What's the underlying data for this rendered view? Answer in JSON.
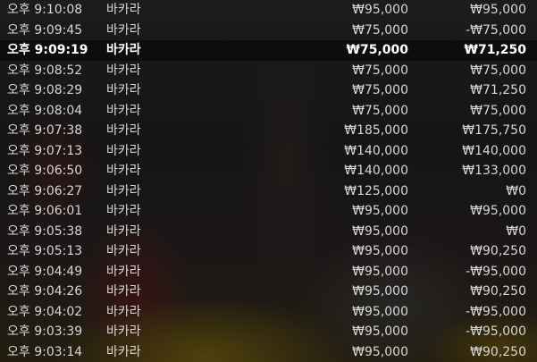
{
  "rows": [
    {
      "time": "오후 9:10:08",
      "game": "바카라",
      "bet": "₩95,000",
      "result": "₩95,000",
      "highlight": false
    },
    {
      "time": "오후 9:09:45",
      "game": "바카라",
      "bet": "₩75,000",
      "result": "-₩75,000",
      "highlight": false
    },
    {
      "time": "오후 9:09:19",
      "game": "바카라",
      "bet": "₩75,000",
      "result": "₩71,250",
      "highlight": true
    },
    {
      "time": "오후 9:08:52",
      "game": "바카라",
      "bet": "₩75,000",
      "result": "₩75,000",
      "highlight": false
    },
    {
      "time": "오후 9:08:29",
      "game": "바카라",
      "bet": "₩75,000",
      "result": "₩71,250",
      "highlight": false
    },
    {
      "time": "오후 9:08:04",
      "game": "바카라",
      "bet": "₩75,000",
      "result": "₩75,000",
      "highlight": false
    },
    {
      "time": "오후 9:07:38",
      "game": "바카라",
      "bet": "₩185,000",
      "result": "₩175,750",
      "highlight": false
    },
    {
      "time": "오후 9:07:13",
      "game": "바카라",
      "bet": "₩140,000",
      "result": "₩140,000",
      "highlight": false
    },
    {
      "time": "오후 9:06:50",
      "game": "바카라",
      "bet": "₩140,000",
      "result": "₩133,000",
      "highlight": false
    },
    {
      "time": "오후 9:06:27",
      "game": "바카라",
      "bet": "₩125,000",
      "result": "₩0",
      "highlight": false
    },
    {
      "time": "오후 9:06:01",
      "game": "바카라",
      "bet": "₩95,000",
      "result": "₩95,000",
      "highlight": false
    },
    {
      "time": "오후 9:05:38",
      "game": "바카라",
      "bet": "₩95,000",
      "result": "₩0",
      "highlight": false
    },
    {
      "time": "오후 9:05:13",
      "game": "바카라",
      "bet": "₩95,000",
      "result": "₩90,250",
      "highlight": false
    },
    {
      "time": "오후 9:04:49",
      "game": "바카라",
      "bet": "₩95,000",
      "result": "-₩95,000",
      "highlight": false
    },
    {
      "time": "오후 9:04:26",
      "game": "바카라",
      "bet": "₩95,000",
      "result": "₩90,250",
      "highlight": false
    },
    {
      "time": "오후 9:04:02",
      "game": "바카라",
      "bet": "₩95,000",
      "result": "-₩95,000",
      "highlight": false
    },
    {
      "time": "오후 9:03:39",
      "game": "바카라",
      "bet": "₩95,000",
      "result": "-₩95,000",
      "highlight": false
    },
    {
      "time": "오후 9:03:14",
      "game": "바카라",
      "bet": "₩95,000",
      "result": "₩90,250",
      "highlight": false
    }
  ]
}
